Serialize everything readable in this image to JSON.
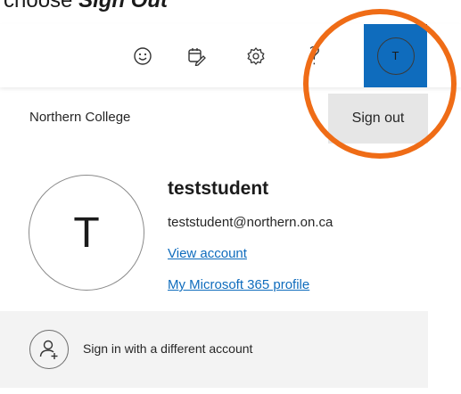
{
  "caption": {
    "prefix": "choose ",
    "emphasis": "Sign Out"
  },
  "toolbar": {
    "icons": [
      "emoji-feedback-icon",
      "calendar-edit-icon",
      "settings-gear-icon",
      "help-icon"
    ],
    "help_glyph": "?",
    "account_initial": "T",
    "account_tile_color": "#0f6cbd"
  },
  "org": {
    "name": "Northern College",
    "sign_out_label": "Sign out"
  },
  "highlight": {
    "color": "#ef6c16"
  },
  "profile": {
    "initial": "T",
    "username": "teststudent",
    "email": "teststudent@northern.on.ca",
    "view_account_label": "View account",
    "ms_profile_label": "My Microsoft 365 profile"
  },
  "other_account": {
    "label": "Sign in with a different account",
    "icon": "add-person-icon"
  }
}
